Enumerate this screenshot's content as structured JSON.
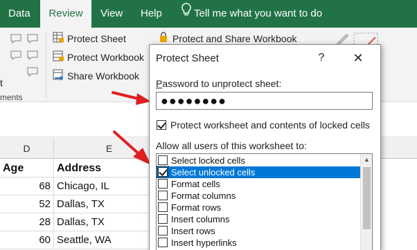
{
  "ribbon": {
    "tabs": [
      {
        "label": "Data",
        "active": false
      },
      {
        "label": "Review",
        "active": true
      },
      {
        "label": "View",
        "active": false
      },
      {
        "label": "Help",
        "active": false
      }
    ],
    "tell_me": "Tell me what you want to do",
    "buttons": {
      "protect_sheet": "Protect Sheet",
      "protect_workbook": "Protect Workbook",
      "share_workbook": "Share Workbook",
      "protect_share_workbook": "Protect and Share Workbook"
    },
    "group_label_partial": "ments",
    "partial_t": "t",
    "colors": {
      "accent": "#217346",
      "ribbon_bg": "#f3f3f3"
    }
  },
  "sheet": {
    "columns": [
      "D",
      "E"
    ],
    "headers": {
      "age": "Age",
      "address": "Address"
    },
    "rows": [
      {
        "age": "68",
        "address": "Chicago, IL"
      },
      {
        "age": "52",
        "address": "Dallas, TX"
      },
      {
        "age": "28",
        "address": "Dallas, TX"
      },
      {
        "age": "60",
        "address": "Seattle, WA"
      }
    ]
  },
  "dialog": {
    "title": "Protect Sheet",
    "help": "?",
    "close": "✕",
    "password_label_pre": "",
    "password_label_ul": "P",
    "password_label_post": "assword to unprotect sheet:",
    "password_value": "●●●●●●●●",
    "protect_check_label": "Protect worksheet and contents of locked cells",
    "protect_checked": true,
    "allow_label": "Allow all users of this worksheet to:",
    "permissions": [
      {
        "label": "Select locked cells",
        "checked": false
      },
      {
        "label": "Select unlocked cells",
        "checked": true,
        "selected": true
      },
      {
        "label": "Format cells",
        "checked": false
      },
      {
        "label": "Format columns",
        "checked": false
      },
      {
        "label": "Format rows",
        "checked": false
      },
      {
        "label": "Insert columns",
        "checked": false
      },
      {
        "label": "Insert rows",
        "checked": false
      },
      {
        "label": "Insert hyperlinks",
        "checked": false
      }
    ]
  }
}
